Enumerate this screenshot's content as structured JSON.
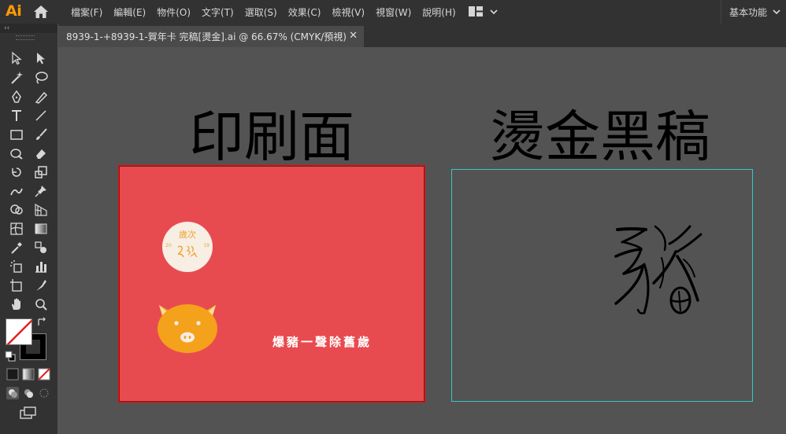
{
  "app": {
    "logo": "Ai"
  },
  "menu": {
    "items": [
      "檔案(F)",
      "編輯(E)",
      "物件(O)",
      "文字(T)",
      "選取(S)",
      "效果(C)",
      "檢視(V)",
      "視窗(W)",
      "說明(H)"
    ],
    "workspace": "基本功能"
  },
  "panel": {
    "collapse": "‹‹"
  },
  "document_tab": {
    "title": "8939-1-+8939-1-賀年卡 完稿[燙金].ai @ 66.67% (CMYK/預視)",
    "close": "✕"
  },
  "canvas": {
    "heading_left": "印刷面",
    "heading_right": "燙金黑稿",
    "card": {
      "seal_top": "歲次",
      "seal_left": "20",
      "seal_right": "19",
      "slogan": "爆豬一聲除舊歲"
    }
  },
  "colors": {
    "card_red": "#e84b4f",
    "pig_orange": "#f4a11c",
    "seal_cream": "#f7eee4",
    "foil_outline": "#3cc4c4",
    "app_orange": "#ff9a00"
  }
}
